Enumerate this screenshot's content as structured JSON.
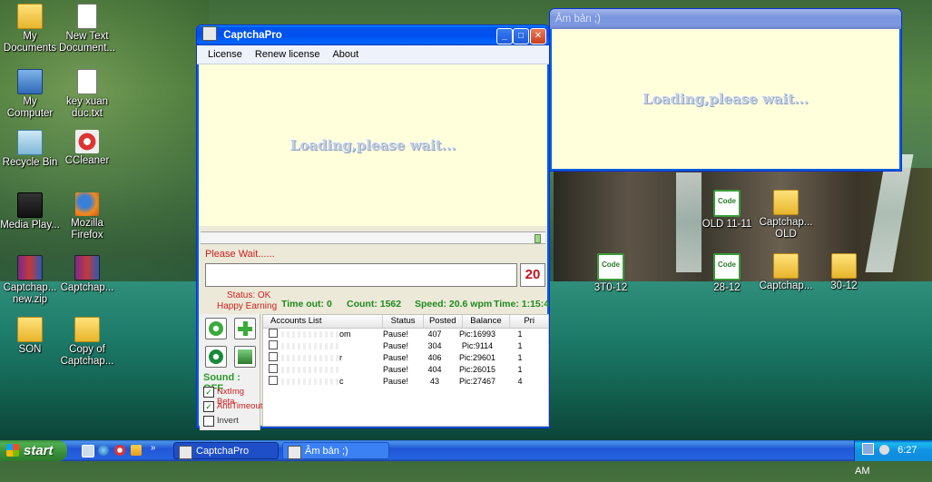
{
  "desktop": {
    "icons_left": [
      {
        "label": "My Documents",
        "kind": "folder"
      },
      {
        "label": "New Text Document...",
        "kind": "doc"
      },
      {
        "label": "My Computer",
        "kind": "pc"
      },
      {
        "label": "key xuan duc.txt",
        "kind": "doc"
      },
      {
        "label": "Recycle Bin",
        "kind": "bin"
      },
      {
        "label": "CCleaner",
        "kind": "cc"
      },
      {
        "label": "Media Play...",
        "kind": "media"
      },
      {
        "label": "Mozilla Firefox",
        "kind": "ff"
      },
      {
        "label": "Captchap... new.zip",
        "kind": "zip"
      },
      {
        "label": "Captchap...",
        "kind": "zip"
      },
      {
        "label": "SON",
        "kind": "folder"
      },
      {
        "label": "Copy of Captchap...",
        "kind": "folder"
      }
    ],
    "icons_right": [
      {
        "label": "OLD 11-11",
        "kind": "code"
      },
      {
        "label": "Captchap... OLD",
        "kind": "folder"
      },
      {
        "label": "3T0-12",
        "kind": "code"
      },
      {
        "label": "28-12",
        "kind": "code"
      },
      {
        "label": "Captchap...",
        "kind": "folder"
      },
      {
        "label": "30-12",
        "kind": "folder"
      }
    ]
  },
  "captchapro": {
    "title": "CaptchaPro",
    "menu": [
      "License",
      "Renew license",
      "About"
    ],
    "loading_text": "Loading,please wait...",
    "please_wait": "Please Wait......",
    "counter": "20",
    "status_ok": "Status: OK",
    "happy_earning": "Happy Earning",
    "timeout": "Time out: 0",
    "count": "Count: 1562",
    "speed": "Speed: 20.6 wpm",
    "time": "Time: 1:15:4",
    "sound": "Sound : OFF",
    "options": [
      {
        "label": "NxtImg Beta",
        "checked": true,
        "color": "#cc1f1f"
      },
      {
        "label": "AntiTimeout",
        "checked": true,
        "color": "#cc1f1f"
      },
      {
        "label": "Invert",
        "checked": false,
        "color": "#333333"
      }
    ],
    "accounts_columns": [
      "Accounts List",
      "Status",
      "Posted",
      "Balance",
      "Pri"
    ],
    "accounts": [
      {
        "account": "om",
        "status": "Pause!",
        "posted": "407",
        "balance": "Pic:16993",
        "pri": "1"
      },
      {
        "account": "",
        "status": "Pause!",
        "posted": "304",
        "balance": "Pic:9114",
        "pri": "1"
      },
      {
        "account": "r",
        "status": "Pause!",
        "posted": "406",
        "balance": "Pic:29601",
        "pri": "1"
      },
      {
        "account": "",
        "status": "Pause!",
        "posted": "404",
        "balance": "Pic:26015",
        "pri": "1"
      },
      {
        "account": "c",
        "status": "Pause!",
        "posted": "43",
        "balance": "Pic:27467",
        "pri": "4"
      }
    ]
  },
  "second_window": {
    "title": "Âm bản ;)",
    "loading_text": "Loading,please wait..."
  },
  "taskbar": {
    "start": "start",
    "tasks": [
      "CaptchaPro",
      "Âm bản ;)"
    ],
    "clock": "6:27 AM"
  }
}
